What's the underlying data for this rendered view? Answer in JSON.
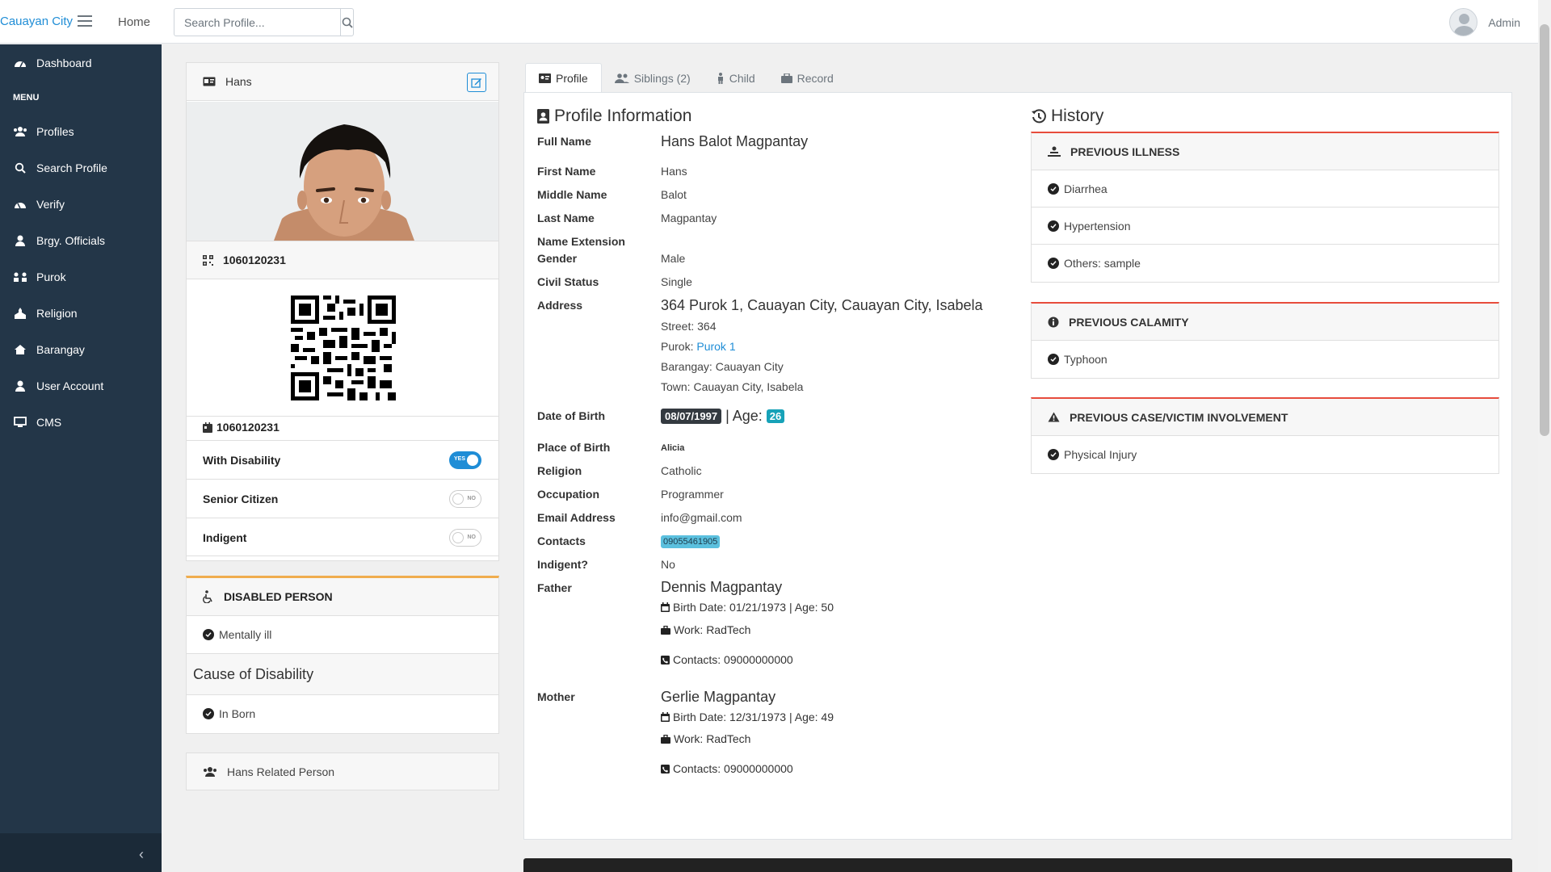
{
  "navbar": {
    "brand": "Cauayan City",
    "home": "Home",
    "search_placeholder": "Search Profile...",
    "user": "Admin"
  },
  "sidebar": {
    "heading": "MENU",
    "items": [
      {
        "label": "Dashboard",
        "icon": "dashboard-icon"
      },
      {
        "label": "Profiles",
        "icon": "users-icon"
      },
      {
        "label": "Search Profile",
        "icon": "search-icon"
      },
      {
        "label": "Verify",
        "icon": "verify-icon"
      },
      {
        "label": "Brgy. Officials",
        "icon": "officials-icon"
      },
      {
        "label": "Purok",
        "icon": "purok-icon"
      },
      {
        "label": "Religion",
        "icon": "religion-icon"
      },
      {
        "label": "Barangay",
        "icon": "home-icon"
      },
      {
        "label": "User Account",
        "icon": "user-icon"
      },
      {
        "label": "CMS",
        "icon": "monitor-icon"
      }
    ]
  },
  "profile_card": {
    "name": "Hans",
    "id_header": "1060120231",
    "id_footer": "1060120231",
    "toggles": [
      {
        "label": "With Disability",
        "state": "YES",
        "on": true
      },
      {
        "label": "Senior Citizen",
        "state": "NO",
        "on": false
      },
      {
        "label": "Indigent",
        "state": "NO",
        "on": false
      }
    ]
  },
  "disabled_card": {
    "title": "DISABLED PERSON",
    "condition": "Mentally ill",
    "cause_title": "Cause of Disability",
    "cause": "In Born"
  },
  "related": {
    "label": "Hans Related Person"
  },
  "tabs": [
    {
      "label": "Profile",
      "icon": "profile-card-icon"
    },
    {
      "label": "Siblings (2)",
      "icon": "siblings-icon"
    },
    {
      "label": "Child",
      "icon": "child-icon"
    },
    {
      "label": "Record",
      "icon": "record-icon"
    }
  ],
  "profile_info": {
    "title": "Profile Information",
    "full_name_label": "Full Name",
    "full_name": "Hans Balot Magpantay",
    "first_name_label": "First Name",
    "first_name": "Hans",
    "middle_name_label": "Middle Name",
    "middle_name": "Balot",
    "last_name_label": "Last Name",
    "last_name": "Magpantay",
    "name_ext_label": "Name Extension",
    "gender_label": "Gender",
    "gender": "Male",
    "civil_status_label": "Civil Status",
    "civil_status": "Single",
    "address_label": "Address",
    "address": "364 Purok 1, Cauayan City, Cauayan City, Isabela",
    "street": "Street: 364",
    "purok_prefix": "Purok:",
    "purok": "Purok 1",
    "barangay": "Barangay: Cauayan City",
    "town": "Town: Cauayan City, Isabela",
    "dob_label": "Date of Birth",
    "dob": "08/07/1997",
    "age_sep": "| Age:",
    "age": "26",
    "pob_label": "Place of Birth",
    "pob": "Alicia",
    "religion_label": "Religion",
    "religion": "Catholic",
    "occupation_label": "Occupation",
    "occupation": "Programmer",
    "email_label": "Email Address",
    "email": "info@gmail.com",
    "contacts_label": "Contacts",
    "contacts": "09055461905",
    "indigent_label": "Indigent?",
    "indigent": "No",
    "father_label": "Father",
    "father_name": "Dennis Magpantay",
    "father_birth": "Birth Date: 01/21/1973 | Age: 50",
    "father_work": "Work: RadTech",
    "father_contacts": "Contacts: 09000000000",
    "mother_label": "Mother",
    "mother_name": "Gerlie Magpantay",
    "mother_birth": "Birth Date: 12/31/1973 | Age: 49",
    "mother_work": "Work: RadTech",
    "mother_contacts": "Contacts: 09000000000"
  },
  "history": {
    "title": "History",
    "illness_title": "PREVIOUS ILLNESS",
    "illness": [
      "Diarrhea",
      "Hypertension",
      "Others: sample"
    ],
    "calamity_title": "PREVIOUS CALAMITY",
    "calamity": [
      "Typhoon"
    ],
    "case_title": "PREVIOUS CASE/VICTIM INVOLVEMENT",
    "case": [
      "Physical Injury"
    ]
  },
  "colors": {
    "sidebar": "#233648",
    "accent": "#1f8dd6",
    "history_border": "#e74c3c",
    "disabled_border": "#f0ad4e"
  }
}
